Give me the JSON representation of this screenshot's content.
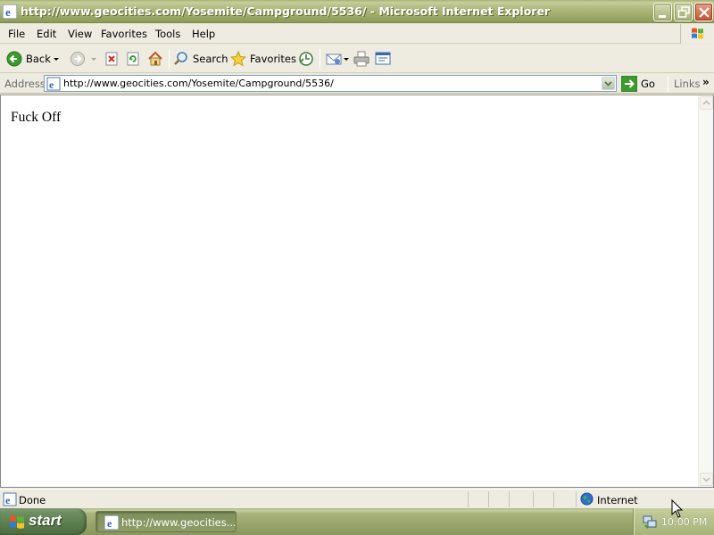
{
  "window": {
    "title": "http://www.geocities.com/Yosemite/Campground/5536/ - Microsoft Internet Explorer",
    "controls": [
      "minimize",
      "restore",
      "close"
    ]
  },
  "menu": {
    "items": [
      "File",
      "Edit",
      "View",
      "Favorites",
      "Tools",
      "Help"
    ]
  },
  "toolbar": {
    "back_label": "Back",
    "search_label": "Search",
    "favorites_label": "Favorites"
  },
  "address": {
    "label": "Address",
    "url": "http://www.geocities.com/Yosemite/Campground/5536/",
    "go_label": "Go",
    "links_label": "Links",
    "links_chevron": "»"
  },
  "page": {
    "text": "Fuck Off"
  },
  "status": {
    "text": "Done",
    "zone": "Internet"
  },
  "taskbar": {
    "start_label": "start",
    "task_label": "http://www.geocities...",
    "clock": "10:00 PM"
  },
  "colors": {
    "titlebar": "#9FAB68",
    "chrome": "#EEECE1",
    "go_arrow": "#3C9A2E",
    "close_button": "#C6502D"
  }
}
